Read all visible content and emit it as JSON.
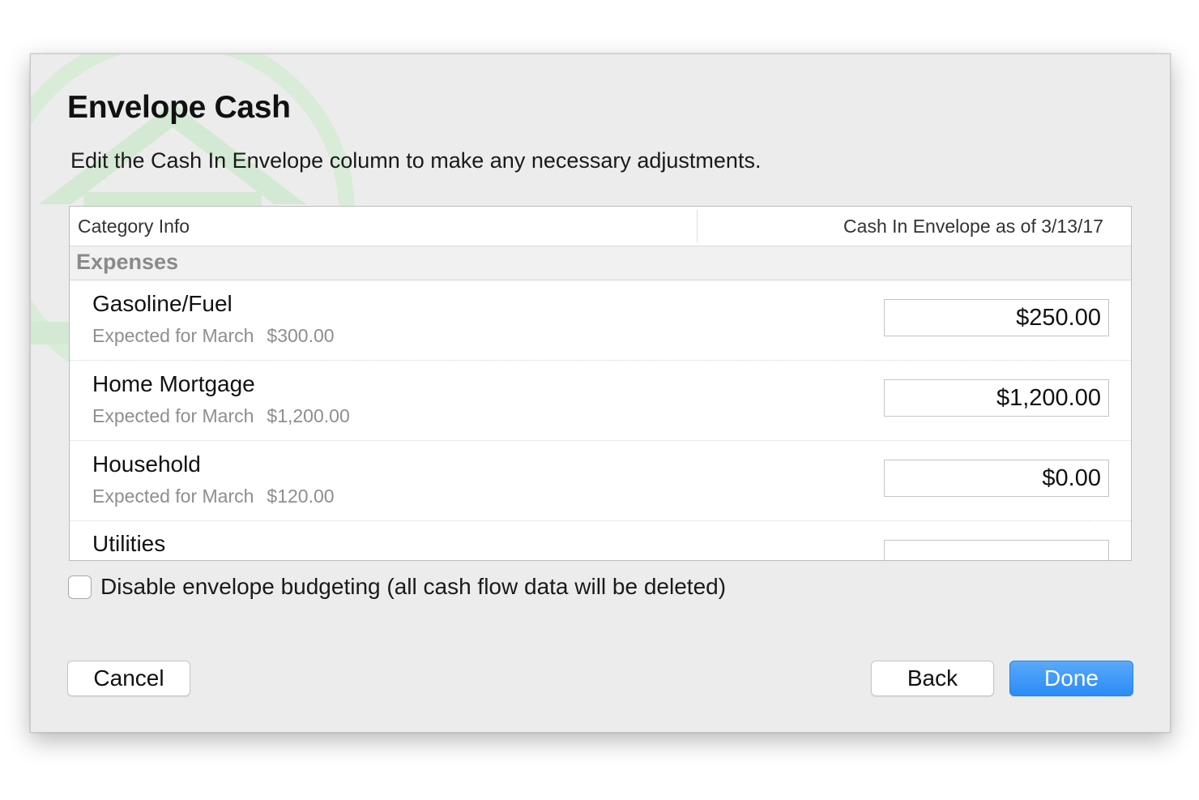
{
  "dialog": {
    "title": "Envelope Cash",
    "subtitle": "Edit the Cash In Envelope column to make any necessary adjustments."
  },
  "table": {
    "header_left": "Category Info",
    "header_right": "Cash In Envelope as of 3/13/17",
    "section_label": "Expenses",
    "rows": [
      {
        "name": "Gasoline/Fuel",
        "expected_label": "Expected for March",
        "expected_amount": "$300.00",
        "cash": "$250.00"
      },
      {
        "name": "Home Mortgage",
        "expected_label": "Expected for March",
        "expected_amount": "$1,200.00",
        "cash": "$1,200.00"
      },
      {
        "name": "Household",
        "expected_label": "Expected for March",
        "expected_amount": "$120.00",
        "cash": "$0.00"
      },
      {
        "name": "Utilities"
      }
    ]
  },
  "disable_checkbox": {
    "label": "Disable envelope budgeting (all cash flow data will be deleted)",
    "checked": false
  },
  "buttons": {
    "cancel": "Cancel",
    "back": "Back",
    "done": "Done"
  },
  "colors": {
    "accent": "#2a8cf5",
    "watermark": "#d8ecd8"
  }
}
